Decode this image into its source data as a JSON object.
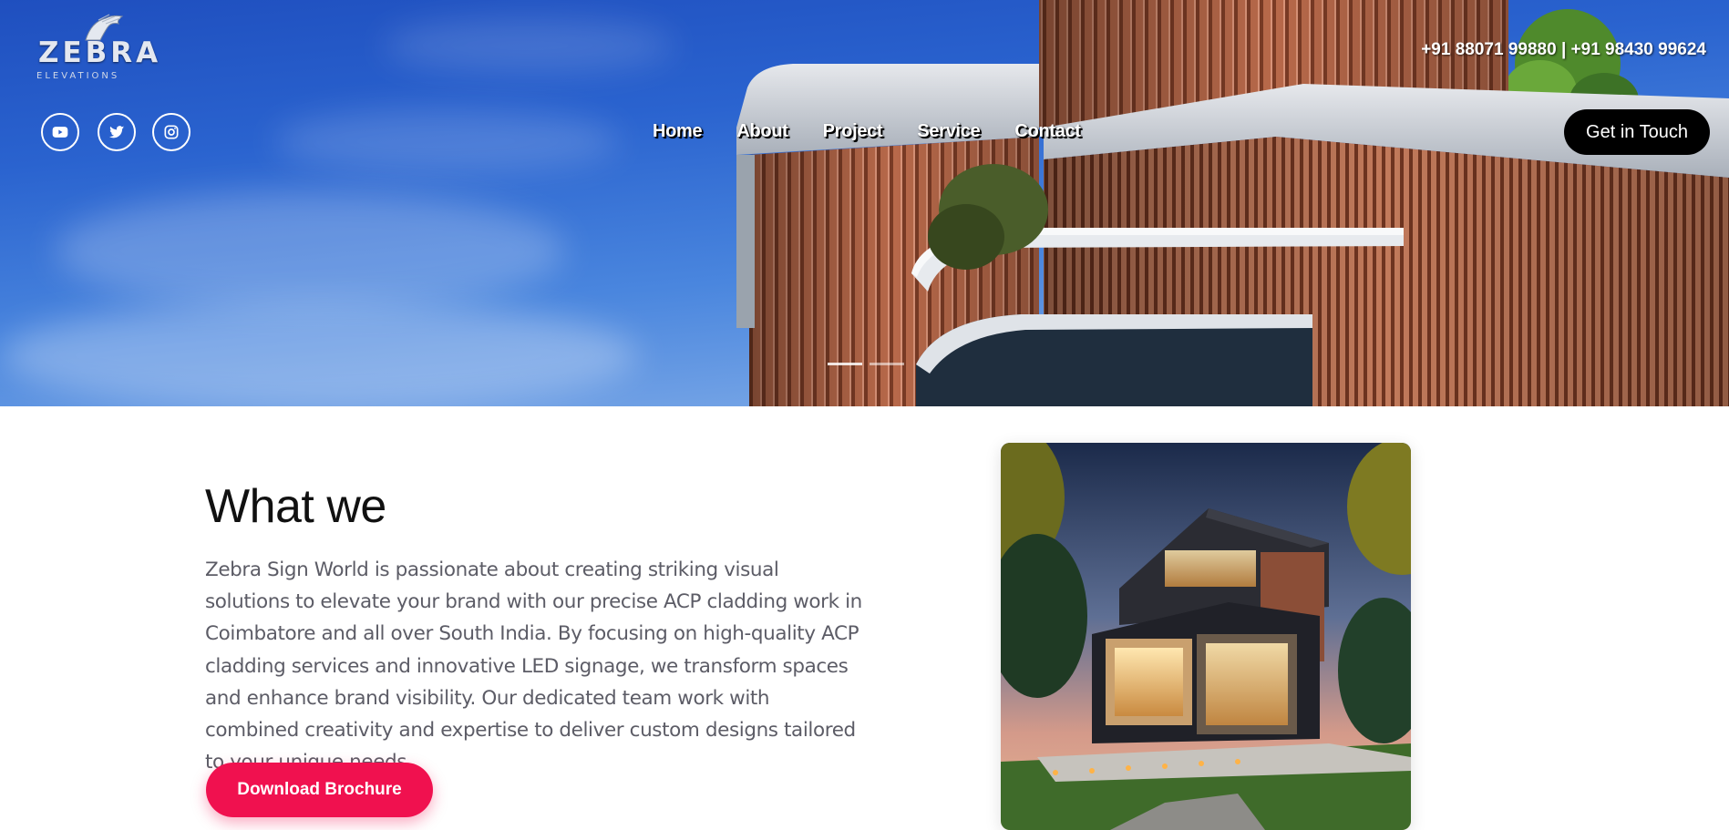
{
  "brand": {
    "logo_text": "ZEBRA",
    "logo_subtext": "ELEVATIONS"
  },
  "header": {
    "phone": "+91 88071 99880 | +91 98430 99624",
    "cta_label": "Get in Touch",
    "nav": [
      {
        "label": "Home"
      },
      {
        "label": "About"
      },
      {
        "label": "Project"
      },
      {
        "label": "Service"
      },
      {
        "label": "Contact"
      }
    ],
    "social": [
      {
        "icon": "youtube-icon"
      },
      {
        "icon": "twitter-icon"
      },
      {
        "icon": "instagram-icon"
      }
    ]
  },
  "slider": {
    "slide_count": 2,
    "active_slide": 1
  },
  "about": {
    "heading": "What we",
    "body": "Zebra Sign World is passionate about creating striking visual solutions to elevate your brand with our precise ACP cladding work in Coimbatore and all over South India. By focusing on high-quality ACP cladding services and innovative LED signage, we transform spaces and enhance brand visibility. Our dedicated team work with combined creativity and expertise to deliver custom designs tailored to your unique needs.",
    "button_label": "Download Brochure"
  },
  "colors": {
    "accent": "#f0114f",
    "cta_bg": "#000000",
    "sky": "#2a63cf"
  }
}
